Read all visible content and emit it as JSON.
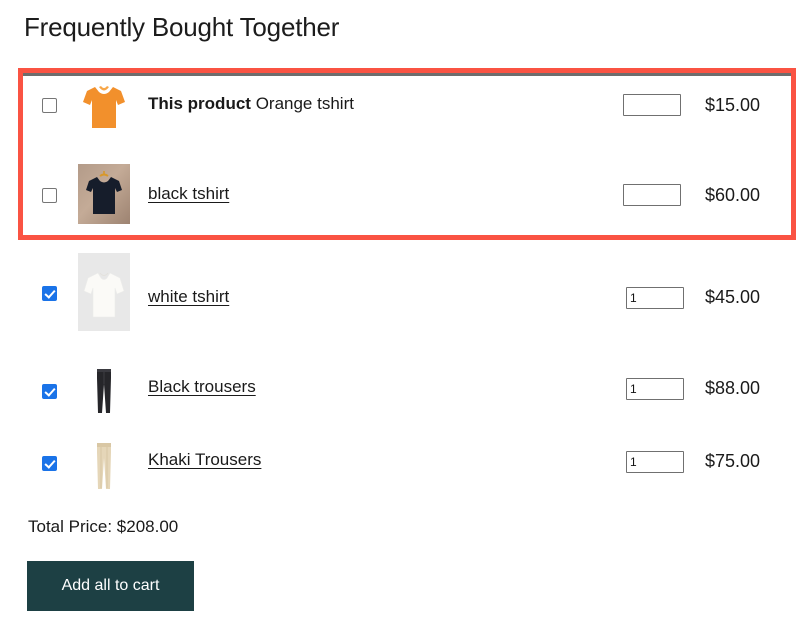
{
  "title": "Frequently Bought Together",
  "highlight": {
    "color": "#fa5343",
    "covers_rows": 2
  },
  "theme": {
    "checkbox_checked_color": "#1a73e8",
    "button_color": "#1d4044",
    "link_color": "#1a1a1a"
  },
  "products": [
    {
      "name_prefix": "This product",
      "name": "Orange tshirt",
      "is_this_product": true,
      "is_link": false,
      "checked": false,
      "quantity": "",
      "price": "$15.00",
      "image_name": "orange-tshirt-thumbnail"
    },
    {
      "name_prefix": "",
      "name": "black tshirt",
      "is_this_product": false,
      "is_link": true,
      "checked": false,
      "quantity": "",
      "price": "$60.00",
      "image_name": "black-tshirt-thumbnail"
    },
    {
      "name_prefix": "",
      "name": "white tshirt",
      "is_this_product": false,
      "is_link": true,
      "checked": true,
      "quantity": "1",
      "price": "$45.00",
      "image_name": "white-tshirt-thumbnail"
    },
    {
      "name_prefix": "",
      "name": "Black trousers",
      "is_this_product": false,
      "is_link": true,
      "checked": true,
      "quantity": "1",
      "price": "$88.00",
      "image_name": "black-trousers-thumbnail"
    },
    {
      "name_prefix": "",
      "name": "Khaki Trousers",
      "is_this_product": false,
      "is_link": true,
      "checked": true,
      "quantity": "1",
      "price": "$75.00",
      "image_name": "khaki-trousers-thumbnail"
    }
  ],
  "total_label": "Total Price: $208.00",
  "add_all_button": "Add all to cart"
}
